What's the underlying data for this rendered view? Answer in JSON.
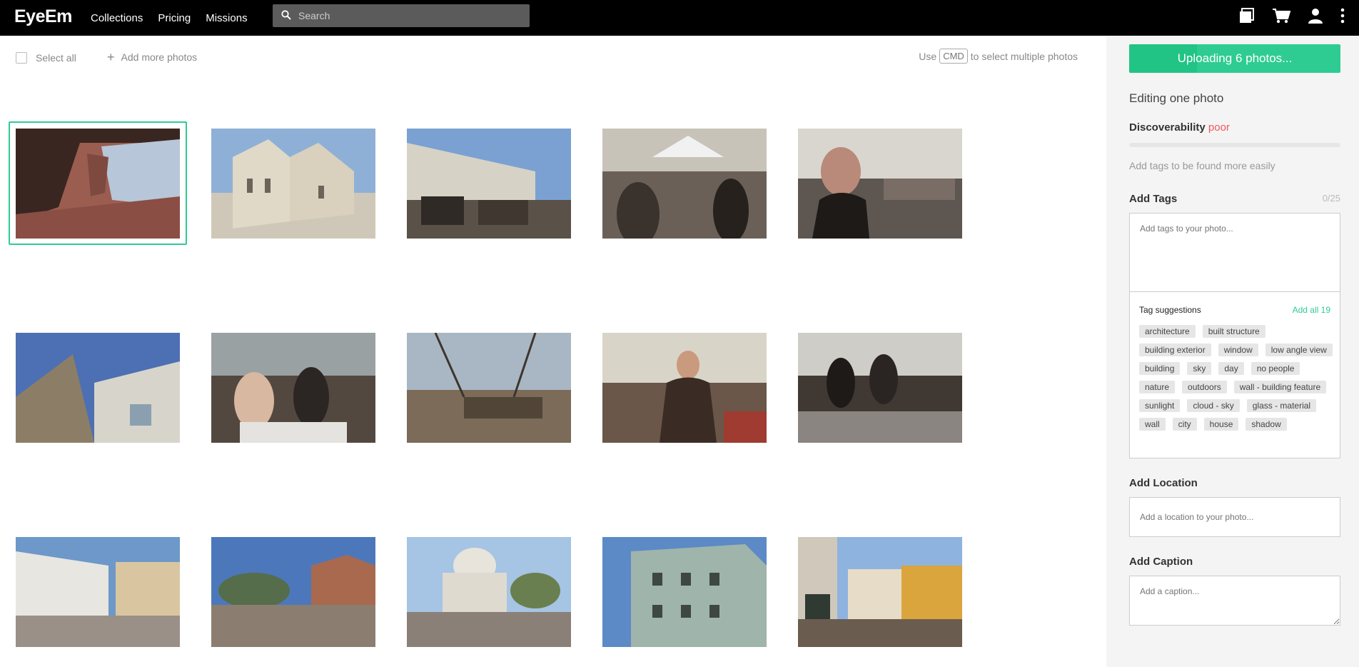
{
  "app": {
    "logo": "EyeEm",
    "nav": [
      {
        "label": "Collections"
      },
      {
        "label": "Pricing"
      },
      {
        "label": "Missions"
      }
    ],
    "search_placeholder": "Search",
    "icons": [
      "photos-icon",
      "cart-icon",
      "user-icon",
      "more-vertical-icon"
    ]
  },
  "toolbar": {
    "select_all": "Select all",
    "add_more": "Add more photos",
    "hint_prefix": "Use",
    "hint_key": "CMD",
    "hint_suffix": "to select multiple photos"
  },
  "panel": {
    "upload_label": "Uploading 6 photos...",
    "upload_progress": 0.32,
    "editing": "Editing one photo",
    "discoverability_label": "Discoverability",
    "discoverability_value": "poor",
    "discoverability_hint": "Add tags to be found more easily",
    "add_tags": "Add Tags",
    "tag_count": "0/25",
    "tags_placeholder": "Add tags to your photo...",
    "tag_suggestions": "Tag suggestions",
    "add_all": "Add all 19",
    "tags": [
      "architecture",
      "built structure",
      "building exterior",
      "window",
      "low angle view",
      "building",
      "sky",
      "day",
      "no people",
      "nature",
      "outdoors",
      "wall - building feature",
      "sunlight",
      "cloud - sky",
      "glass - material",
      "wall",
      "city",
      "house",
      "shadow"
    ],
    "add_location": "Add Location",
    "location_placeholder": "Add a location to your photo...",
    "add_caption": "Add Caption",
    "caption_placeholder": "Add a caption..."
  },
  "colors": {
    "accent": "#2ecc92",
    "poor": "#f1575b",
    "topbar": "#000000"
  }
}
